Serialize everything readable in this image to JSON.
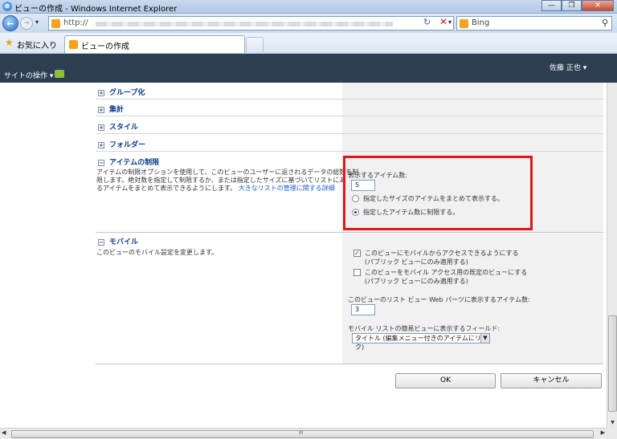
{
  "window": {
    "title": "ビューの作成 - Windows Internet Explorer",
    "min": "—",
    "restore": "❐",
    "close": "✕"
  },
  "address": {
    "url_prefix": "http://",
    "search_provider": "Bing"
  },
  "favorites": {
    "label": "お気に入り",
    "tab_title": "ビューの作成"
  },
  "ribbon": {
    "site_actions": "サイトの操作 ▾",
    "user": "佐藤 正也 ▾"
  },
  "sections": {
    "group": "グループ化",
    "totals": "集計",
    "style": "スタイル",
    "folders": "フォルダー",
    "limit": "アイテムの制限",
    "mobile": "モバイル"
  },
  "limit": {
    "desc_line1": "アイテムの制限オプションを使用して、このビューのユーザーに返されるデータの総数を制",
    "desc_line2": "限します。絶対数を指定して制限するか、または指定したサイズに基づいてリストにあ",
    "desc_line3": "るアイテムをまとめて表示できるようにします。",
    "desc_link": "大きなリストの管理に関する詳細",
    "count_label": "表示するアイテム数:",
    "count_value": "5",
    "option_batch": "指定したサイズのアイテムをまとめて表示する。",
    "option_limit": "指定したアイテム数に制限する。",
    "selected": "option_limit"
  },
  "mobile": {
    "desc": "このビューのモバイル設定を変更します。",
    "check1_line1": "このビューにモバイルからアクセスできるようにする",
    "check1_line2": "(パブリック ビューにのみ適用する)",
    "check1_checked": true,
    "check2_line1": "このビューをモバイル アクセス用の既定のビューにする",
    "check2_line2": "(パブリック ビューにのみ適用する)",
    "check2_checked": false,
    "webpart_label": "このビューのリスト ビュー Web パーツに表示するアイテム数:",
    "webpart_value": "3",
    "field_label": "モバイル リストの簡易ビューに表示するフィールド:",
    "field_value": "タイトル (編集メニュー付きのアイテムにリンク)"
  },
  "buttons": {
    "ok": "OK",
    "cancel": "キャンセル"
  },
  "scroll": {
    "grip": "III"
  }
}
